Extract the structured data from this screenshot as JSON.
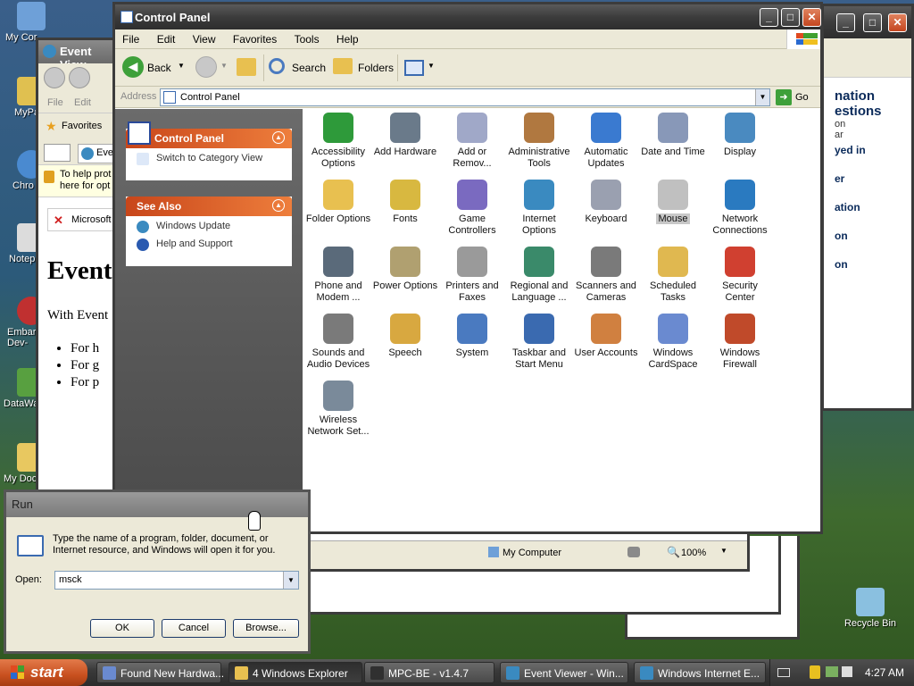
{
  "desktop_icons": [
    {
      "label": "My Cor",
      "color": "#6ea0d8",
      "icon": "my-computer-icon"
    },
    {
      "label": "MyPa",
      "color": "#e0c050",
      "icon": "my-pa-icon"
    },
    {
      "label": "Chro",
      "color": "#4a8ad0",
      "icon": "chrome-icon"
    },
    {
      "label": "Notep",
      "color": "#dcdcdc",
      "icon": "notepad-icon"
    },
    {
      "label": "Embarc\nDev-",
      "color": "#c03030",
      "icon": "embarcadero-icon"
    },
    {
      "label": "DataWa",
      "color": "#58a040",
      "icon": "datawa-icon"
    },
    {
      "label": "My Doc",
      "color": "#e8c860",
      "icon": "my-documents-icon"
    },
    {
      "label": "Recycle Bin",
      "color": "#8ac0e0",
      "icon": "recycle-bin-icon"
    }
  ],
  "ie_window": {
    "text_lines": [
      "nation",
      "estions",
      "on",
      "ar",
      "yed in",
      "er",
      "ation",
      "on",
      "on"
    ]
  },
  "event_viewer_window": {
    "title": "Event View",
    "menu": [
      "File",
      "Edit"
    ],
    "favorites": "Favorites",
    "tab": "Eve",
    "info": "To help prot\nhere for opt",
    "tab2": "Microsoft",
    "heading": "Event",
    "para": "With Event",
    "bullets": [
      "For h",
      "For g",
      "For p"
    ]
  },
  "control_panel": {
    "title": "Control Panel",
    "menu": [
      "File",
      "Edit",
      "View",
      "Favorites",
      "Tools",
      "Help"
    ],
    "toolbar": {
      "back": "Back",
      "search": "Search",
      "folders": "Folders"
    },
    "address_label": "Address",
    "address_value": "Control Panel",
    "go_label": "Go",
    "sidebar": {
      "panel_title": "Control Panel",
      "switch_link": "Switch to Category View",
      "see_also": "See Also",
      "links": [
        "Windows Update",
        "Help and Support"
      ]
    },
    "items": [
      {
        "label": "Accessibility\nOptions",
        "color": "#2e9a3a",
        "icon": "accessibility-icon"
      },
      {
        "label": "Add Hardware",
        "color": "#6a7a8a",
        "icon": "add-hardware-icon"
      },
      {
        "label": "Add or\nRemov...",
        "color": "#a0a8c8",
        "icon": "add-remove-programs-icon"
      },
      {
        "label": "Administrative\nTools",
        "color": "#b07840",
        "icon": "administrative-tools-icon"
      },
      {
        "label": "Automatic\nUpdates",
        "color": "#3a7ad0",
        "icon": "automatic-updates-icon"
      },
      {
        "label": "Date and Time",
        "color": "#8898b8",
        "icon": "date-time-icon"
      },
      {
        "label": "Display",
        "color": "#4a8ac0",
        "icon": "display-icon"
      },
      {
        "label": "Folder Options",
        "color": "#e8c050",
        "icon": "folder-options-icon"
      },
      {
        "label": "Fonts",
        "color": "#d8b840",
        "icon": "fonts-icon"
      },
      {
        "label": "Game\nControllers",
        "color": "#7a6ac0",
        "icon": "game-controllers-icon"
      },
      {
        "label": "Internet\nOptions",
        "color": "#3a8ac0",
        "icon": "internet-options-icon"
      },
      {
        "label": "Keyboard",
        "color": "#9aa0b0",
        "icon": "keyboard-icon"
      },
      {
        "label": "Mouse",
        "color": "#c0c0c0",
        "icon": "mouse-icon",
        "selected": true
      },
      {
        "label": "Network\nConnections",
        "color": "#2a7ac0",
        "icon": "network-connections-icon"
      },
      {
        "label": "Phone and\nModem ...",
        "color": "#5a6a7a",
        "icon": "phone-modem-icon"
      },
      {
        "label": "Power Options",
        "color": "#b0a070",
        "icon": "power-options-icon"
      },
      {
        "label": "Printers and\nFaxes",
        "color": "#9a9a9a",
        "icon": "printers-faxes-icon"
      },
      {
        "label": "Regional and\nLanguage ...",
        "color": "#3a8a6a",
        "icon": "regional-language-icon"
      },
      {
        "label": "Scanners and\nCameras",
        "color": "#7a7a7a",
        "icon": "scanners-cameras-icon"
      },
      {
        "label": "Scheduled\nTasks",
        "color": "#e0b850",
        "icon": "scheduled-tasks-icon"
      },
      {
        "label": "Security\nCenter",
        "color": "#d04030",
        "icon": "security-center-icon"
      },
      {
        "label": "Sounds and\nAudio Devices",
        "color": "#7a7a7a",
        "icon": "sounds-audio-icon"
      },
      {
        "label": "Speech",
        "color": "#d8a840",
        "icon": "speech-icon"
      },
      {
        "label": "System",
        "color": "#4a7ac0",
        "icon": "system-icon"
      },
      {
        "label": "Taskbar and\nStart Menu",
        "color": "#3a6ab0",
        "icon": "taskbar-start-menu-icon"
      },
      {
        "label": "User Accounts",
        "color": "#d08040",
        "icon": "user-accounts-icon"
      },
      {
        "label": "Windows\nCardSpace",
        "color": "#6a8ad0",
        "icon": "cardspace-icon"
      },
      {
        "label": "Windows\nFirewall",
        "color": "#c04a2a",
        "icon": "windows-firewall-icon"
      },
      {
        "label": "Wireless\nNetwork Set...",
        "color": "#7a8a9a",
        "icon": "wireless-network-icon"
      }
    ]
  },
  "mycomputer_status": {
    "label": "My Computer",
    "zoom": "100%"
  },
  "run_dialog": {
    "title": "Run",
    "description": "Type the name of a program, folder, document, or Internet resource, and Windows will open it for you.",
    "open_label": "Open:",
    "open_value": "msck",
    "ok": "OK",
    "cancel": "Cancel",
    "browse": "Browse..."
  },
  "taskbar": {
    "start": "start",
    "buttons": [
      {
        "label": "Found New Hardwa...",
        "color": "#6a8ad0",
        "icon": "hardware-wizard-icon"
      },
      {
        "label": "4 Windows Explorer",
        "color": "#e8c050",
        "icon": "explorer-folder-icon",
        "active": true
      },
      {
        "label": "MPC-BE - v1.4.7",
        "color": "#303030",
        "icon": "mpc-be-icon"
      },
      {
        "label": "Event Viewer - Win...",
        "color": "#3a8ac0",
        "icon": "ie-icon"
      },
      {
        "label": "Windows Internet E...",
        "color": "#3a8ac0",
        "icon": "ie-icon"
      }
    ],
    "clock": "4:27 AM"
  }
}
